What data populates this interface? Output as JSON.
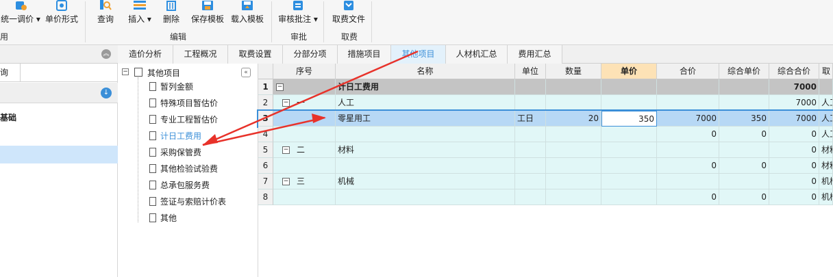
{
  "ribbon": {
    "buttons": [
      {
        "label": "统一调价 ▾",
        "icon": "adjust-price-icon"
      },
      {
        "label": "单价形式",
        "icon": "price-form-icon"
      },
      {
        "label": "查询",
        "icon": "query-icon"
      },
      {
        "label": "插入 ▾",
        "icon": "insert-icon"
      },
      {
        "label": "删除",
        "icon": "delete-icon"
      },
      {
        "label": "保存模板",
        "icon": "save-template-icon"
      },
      {
        "label": "载入模板",
        "icon": "load-template-icon"
      },
      {
        "label": "审核批注 ▾",
        "icon": "review-comment-icon"
      },
      {
        "label": "取费文件",
        "icon": "fee-file-icon"
      }
    ],
    "groups": {
      "yong": "用",
      "edit": "编辑",
      "approve": "审批",
      "fee": "取费"
    }
  },
  "tabs": [
    "造价分析",
    "工程概况",
    "取费设置",
    "分部分项",
    "措施项目",
    "其他项目",
    "人材机汇总",
    "费用汇总"
  ],
  "active_tab": "其他项目",
  "left_panel": {
    "tab_label": "询",
    "section_label": "基础"
  },
  "tree": {
    "root": "其他项目",
    "items": [
      "暂列金额",
      "特殊项目暂估价",
      "专业工程暂估价",
      "计日工费用",
      "采购保管费",
      "其他检验试验费",
      "总承包服务费",
      "签证与索赔计价表",
      "其他"
    ],
    "selected": "计日工费用"
  },
  "grid": {
    "columns": [
      "序号",
      "名称",
      "单位",
      "数量",
      "单价",
      "合价",
      "综合单价",
      "综合合价",
      "取"
    ],
    "rows": [
      {
        "n": "1",
        "seq": "",
        "name": "计日工费用",
        "unit": "",
        "qty": "",
        "price": "",
        "total": "",
        "unit_price": "",
        "sum": "7000",
        "fee": ""
      },
      {
        "n": "2",
        "seq": "一",
        "name": "人工",
        "unit": "",
        "qty": "",
        "price": "",
        "total": "",
        "unit_price": "",
        "sum": "7000",
        "fee": "人工"
      },
      {
        "n": "3",
        "seq": "",
        "name": "零星用工",
        "unit": "工日",
        "qty": "20",
        "price": "350",
        "total": "7000",
        "unit_price": "350",
        "sum": "7000",
        "fee": "人工"
      },
      {
        "n": "4",
        "seq": "",
        "name": "",
        "unit": "",
        "qty": "",
        "price": "",
        "total": "0",
        "unit_price": "0",
        "sum": "0",
        "fee": "人工"
      },
      {
        "n": "5",
        "seq": "二",
        "name": "材料",
        "unit": "",
        "qty": "",
        "price": "",
        "total": "",
        "unit_price": "",
        "sum": "0",
        "fee": "材料"
      },
      {
        "n": "6",
        "seq": "",
        "name": "",
        "unit": "",
        "qty": "",
        "price": "",
        "total": "0",
        "unit_price": "0",
        "sum": "0",
        "fee": "材料"
      },
      {
        "n": "7",
        "seq": "三",
        "name": "机械",
        "unit": "",
        "qty": "",
        "price": "",
        "total": "",
        "unit_price": "",
        "sum": "0",
        "fee": "机械"
      },
      {
        "n": "8",
        "seq": "",
        "name": "",
        "unit": "",
        "qty": "",
        "price": "",
        "total": "0",
        "unit_price": "0",
        "sum": "0",
        "fee": "机械"
      }
    ]
  },
  "colors": {
    "accent": "#3b8fd8",
    "annotation": "#e8322a",
    "selected_row": "#b7d8f5",
    "group_row": "#c4c4c4",
    "row_bg": "#e1f7f7"
  }
}
